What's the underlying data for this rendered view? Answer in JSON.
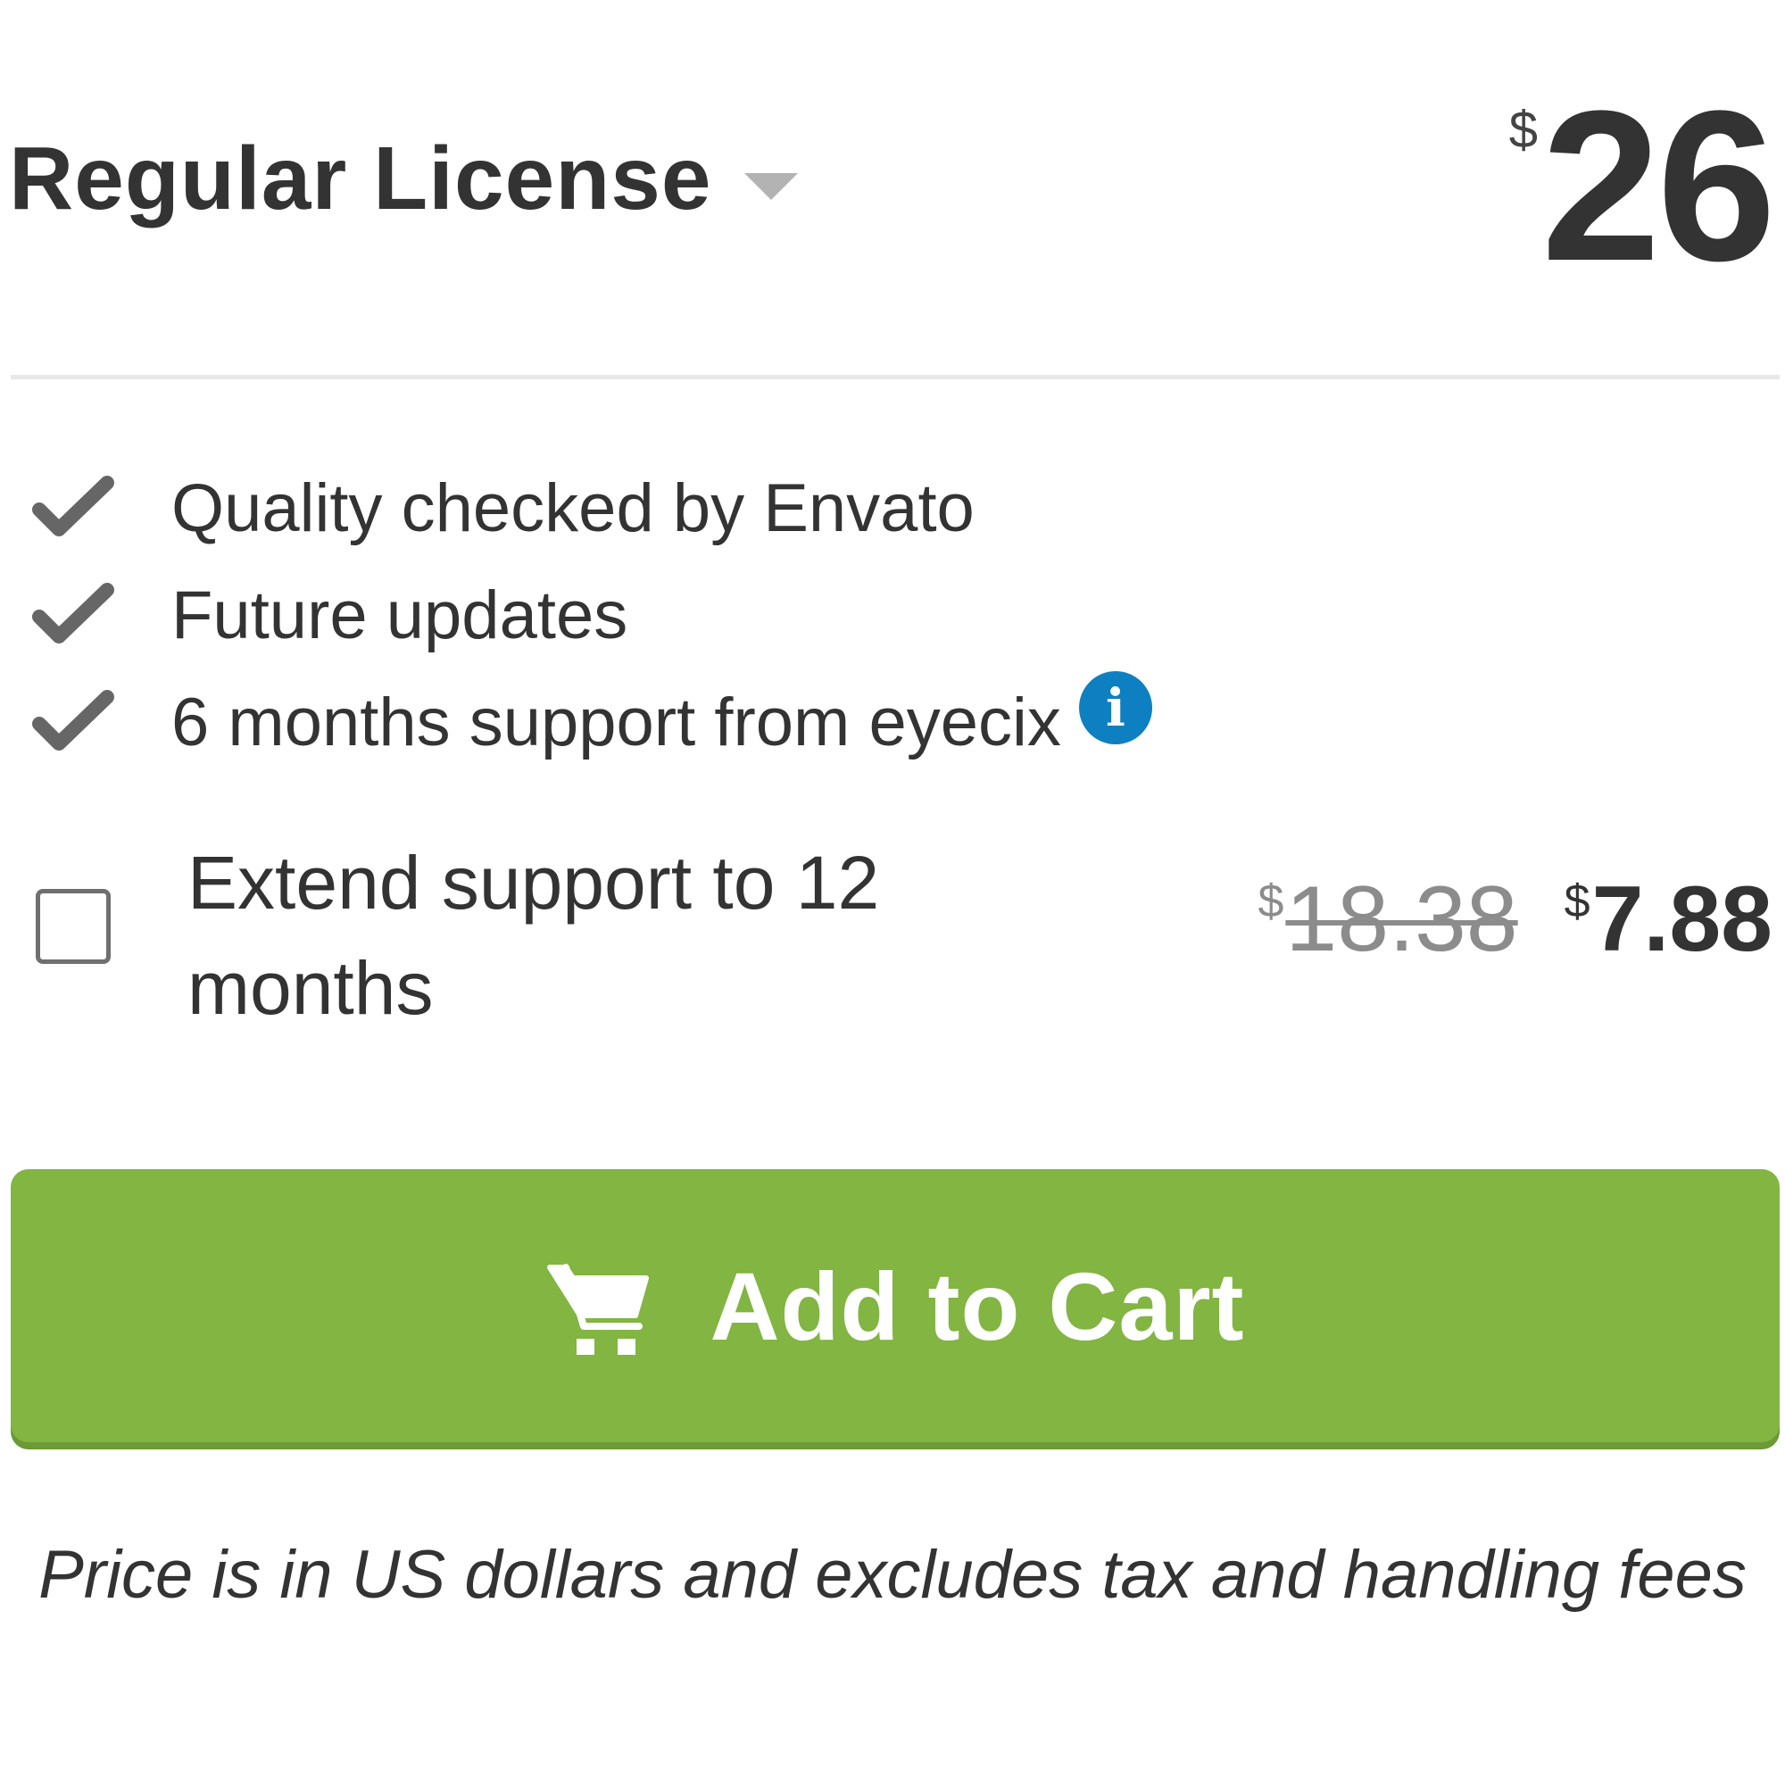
{
  "license": {
    "label": "Regular License",
    "currency_symbol": "$",
    "price": "26"
  },
  "features": [
    {
      "text": "Quality checked by Envato",
      "icon": "checkmark-icon"
    },
    {
      "text": "Future updates",
      "icon": "checkmark-icon"
    },
    {
      "text": "6 months support from eyecix",
      "icon": "checkmark-icon",
      "info_icon": "info-icon"
    }
  ],
  "extend_support": {
    "label": "Extend support to 12 months",
    "checked": false,
    "currency_symbol": "$",
    "old_price": "18.38",
    "new_price": "7.88"
  },
  "cart_button": {
    "label": "Add to Cart",
    "icon": "cart-icon"
  },
  "footnote": "Price is in US dollars and excludes tax and handling fees",
  "colors": {
    "accent_green": "#82b541",
    "info_blue": "#0e7fc0",
    "text": "#333333",
    "muted": "#8c8c8c"
  }
}
